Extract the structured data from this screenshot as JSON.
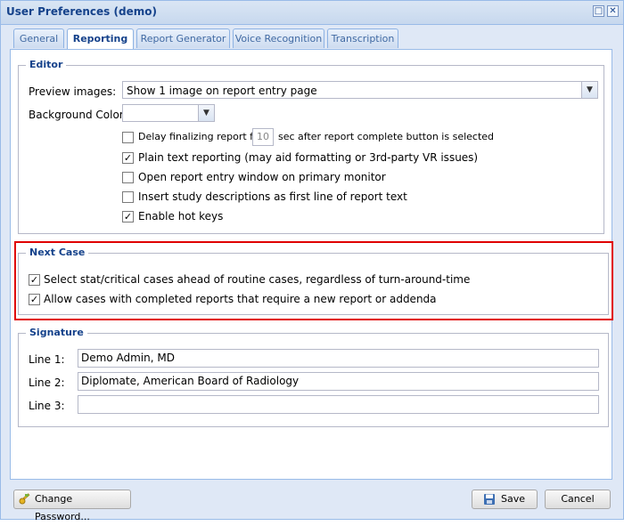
{
  "window": {
    "title": "User Preferences (demo)",
    "tools": {
      "maximize": "□",
      "close": "✕"
    }
  },
  "tabs": [
    {
      "label": "General",
      "active": false
    },
    {
      "label": "Reporting",
      "active": true
    },
    {
      "label": "Report Generator",
      "active": false
    },
    {
      "label": "Voice Recognition",
      "active": false
    },
    {
      "label": "Transcription",
      "active": false
    }
  ],
  "editor": {
    "legend": "Editor",
    "preview_label": "Preview images:",
    "preview_value": "Show 1 image on report entry page",
    "bgcolor_label": "Background Color:",
    "bgcolor_value": "",
    "delay": {
      "checked": false,
      "text_before": "Delay finalizing report for",
      "seconds": "10",
      "text_after": "sec after report complete button is selected"
    },
    "options": [
      {
        "label": "Plain text reporting (may aid formatting or 3rd-party VR issues)",
        "checked": true
      },
      {
        "label": "Open report entry window on primary monitor",
        "checked": false
      },
      {
        "label": "Insert study descriptions as first line of report text",
        "checked": false
      },
      {
        "label": "Enable hot keys",
        "checked": true
      }
    ]
  },
  "next_case": {
    "legend": "Next Case",
    "options": [
      {
        "label": "Select stat/critical cases ahead of routine cases, regardless of turn-around-time",
        "checked": true
      },
      {
        "label": "Allow cases with completed reports that require a new report or addenda",
        "checked": true
      }
    ]
  },
  "signature": {
    "legend": "Signature",
    "lines": [
      {
        "label": "Line 1:",
        "value": "Demo Admin, MD"
      },
      {
        "label": "Line 2:",
        "value": "Diplomate, American Board of Radiology"
      },
      {
        "label": "Line 3:",
        "value": ""
      }
    ]
  },
  "footer": {
    "change_password": "Change Password...",
    "save": "Save",
    "cancel": "Cancel"
  },
  "glyphs": {
    "check": "✓",
    "dropdown": "▼"
  }
}
